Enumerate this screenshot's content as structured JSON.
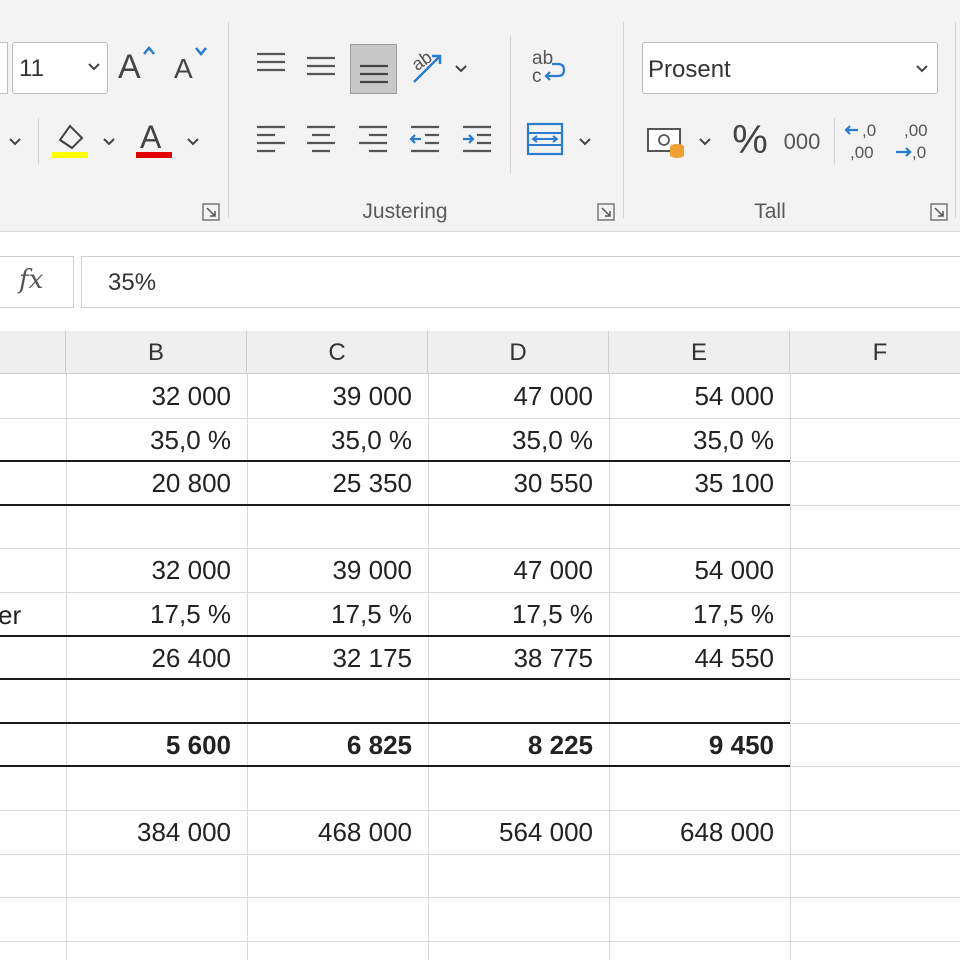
{
  "ribbon": {
    "font_size": "11",
    "number_format": "Prosent",
    "groups": {
      "alignment_label": "Justering",
      "number_label": "Tall"
    },
    "icons": [
      "increase-font-icon",
      "decrease-font-icon",
      "fill-color-icon",
      "font-color-icon",
      "align-top-icon",
      "align-middle-icon",
      "align-bottom-icon",
      "orientation-icon",
      "align-left-icon",
      "align-center-icon",
      "align-right-icon",
      "decrease-indent-icon",
      "increase-indent-icon",
      "wrap-text-icon",
      "merge-center-icon",
      "accounting-format-icon",
      "percent-icon",
      "comma-style-icon",
      "increase-decimal-icon",
      "decrease-decimal-icon"
    ],
    "labels": {
      "increase_font": "A",
      "decrease_font": "A",
      "font_color": "A",
      "percent": "%",
      "thousands": "000",
      "wrap_text": "ab\nc",
      "inc_decimal_top": ",0",
      "inc_decimal_bottom": ",00",
      "dec_decimal_top": ",00",
      "dec_decimal_bottom": ",0"
    },
    "colors": {
      "fill_color": "#ffff00",
      "font_color": "#e00000",
      "accent_blue": "#2b7bd0"
    }
  },
  "formula_bar": {
    "fx_label": "fx",
    "value": "35%"
  },
  "sheet": {
    "columns": [
      "B",
      "C",
      "D",
      "E",
      "F"
    ],
    "row_label_fragment": "er",
    "rows": [
      [
        "32 000",
        "39 000",
        "47 000",
        "54 000"
      ],
      [
        "35,0 %",
        "35,0 %",
        "35,0 %",
        "35,0 %"
      ],
      [
        "20 800",
        "25 350",
        "30 550",
        "35 100"
      ],
      [
        "",
        "",
        "",
        ""
      ],
      [
        "32 000",
        "39 000",
        "47 000",
        "54 000"
      ],
      [
        "17,5 %",
        "17,5 %",
        "17,5 %",
        "17,5 %"
      ],
      [
        "26 400",
        "32 175",
        "38 775",
        "44 550"
      ],
      [
        "",
        "",
        "",
        ""
      ],
      [
        "5 600",
        "6 825",
        "8 225",
        "9 450"
      ],
      [
        "",
        "",
        "",
        ""
      ],
      [
        "384 000",
        "468 000",
        "564 000",
        "648 000"
      ]
    ]
  }
}
